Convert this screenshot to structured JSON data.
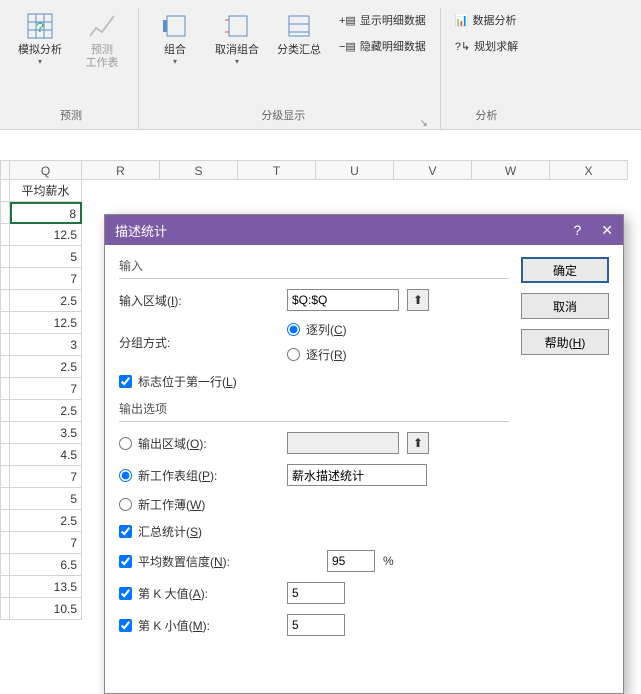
{
  "ribbon": {
    "forecast": {
      "scenario": "模拟分析",
      "forecast_sheet_l1": "预测",
      "forecast_sheet_l2": "工作表",
      "title": "预测"
    },
    "outline": {
      "group": "组合",
      "ungroup": "取消组合",
      "subtotal": "分类汇总",
      "show_detail": "显示明细数据",
      "hide_detail": "隐藏明细数据",
      "title": "分级显示"
    },
    "analysis": {
      "data_analysis": "数据分析",
      "solver": "规划求解",
      "title": "分析"
    }
  },
  "columns": [
    "Q",
    "R",
    "S",
    "T",
    "U",
    "V",
    "W",
    "X"
  ],
  "sheet": {
    "header": "平均薪水",
    "values": [
      "8",
      "12.5",
      "5",
      "7",
      "2.5",
      "12.5",
      "3",
      "2.5",
      "7",
      "2.5",
      "3.5",
      "4.5",
      "7",
      "5",
      "2.5",
      "7",
      "6.5",
      "13.5",
      "10.5"
    ]
  },
  "dialog": {
    "title": "描述统计",
    "help_sym": "?",
    "ok": "确定",
    "cancel": "取消",
    "help": "帮助(",
    "help_u": "H",
    "help_end": ")",
    "input_section": "输入",
    "input_range": "输入区域(",
    "input_range_u": "I",
    "input_range_end": "):",
    "input_range_val": "$Q:$Q",
    "grouped_by": "分组方式:",
    "by_col": "逐列(",
    "by_col_u": "C",
    "by_col_end": ")",
    "by_row": "逐行(",
    "by_row_u": "R",
    "by_row_end": ")",
    "labels_first": "标志位于第一行(",
    "labels_first_u": "L",
    "labels_first_end": ")",
    "output_section": "输出选项",
    "out_range": "输出区域(",
    "out_range_u": "O",
    "out_range_end": "):",
    "new_ws": "新工作表组(",
    "new_ws_u": "P",
    "new_ws_end": "):",
    "new_ws_val": "薪水描述统计",
    "new_wb": "新工作薄(",
    "new_wb_u": "W",
    "new_wb_end": ")",
    "summary": "汇总统计(",
    "summary_u": "S",
    "summary_end": ")",
    "confidence": "平均数置信度(",
    "confidence_u": "N",
    "confidence_end": "):",
    "confidence_val": "95",
    "percent": "%",
    "kth_large": "第 K 大值(",
    "kth_large_u": "A",
    "kth_large_end": "):",
    "kth_large_val": "5",
    "kth_small": "第 K 小值(",
    "kth_small_u": "M",
    "kth_small_end": "):",
    "kth_small_val": "5",
    "ref_arrow": "⬆"
  }
}
